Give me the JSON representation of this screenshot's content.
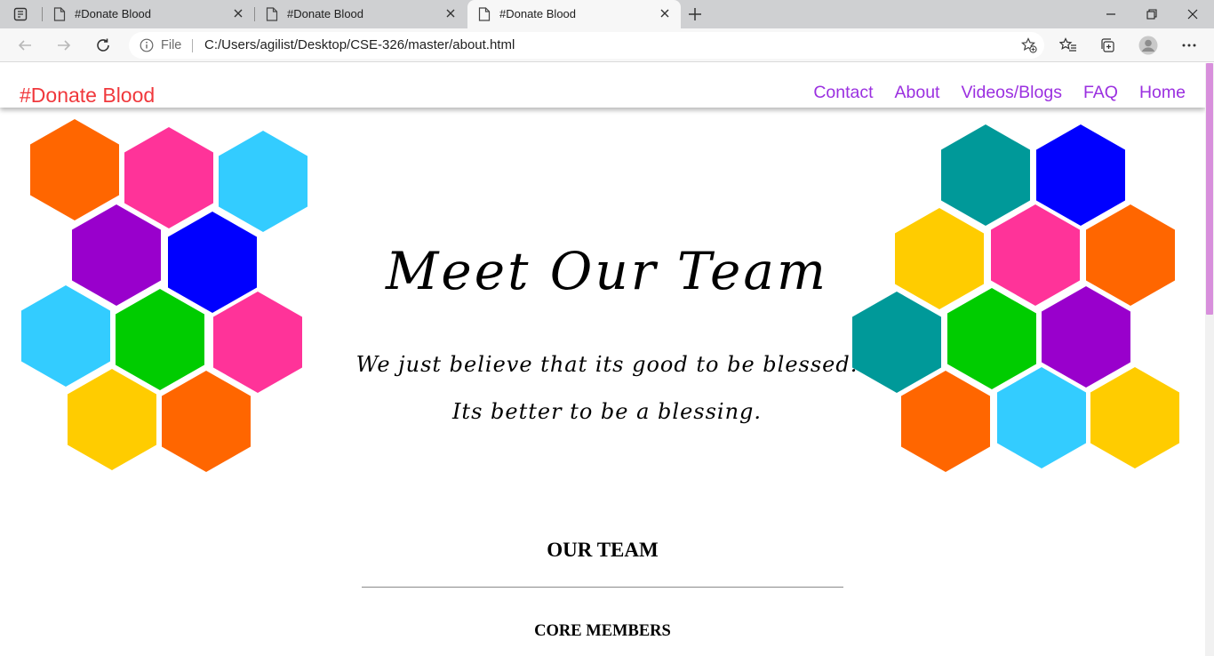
{
  "browser": {
    "tabs": [
      {
        "title": "#Donate Blood"
      },
      {
        "title": "#Donate Blood"
      },
      {
        "title": "#Donate Blood"
      }
    ],
    "address": {
      "scheme": "File",
      "url": "C:/Users/agilist/Desktop/CSE-326/master/about.html"
    }
  },
  "nav": {
    "brand": "#Donate Blood",
    "links": [
      "Contact",
      "About",
      "Videos/Blogs",
      "FAQ",
      "Home"
    ]
  },
  "hero": {
    "title": "Meet Our Team",
    "subtitle_line1": "We just believe that its good to be blessed.",
    "subtitle_line2": "Its better to be a blessing."
  },
  "team": {
    "heading": "OUR TEAM",
    "core_heading": "CORE MEMBERS"
  },
  "colors": {
    "brand": "#f0383c",
    "nav_link": "#9b30e0",
    "scroll_thumb": "#d88fdc",
    "hex_palette": [
      "#ff6600",
      "#ff3399",
      "#33ccff",
      "#9900cc",
      "#0000ff",
      "#00cc00",
      "#ffcc00",
      "#009999"
    ]
  }
}
